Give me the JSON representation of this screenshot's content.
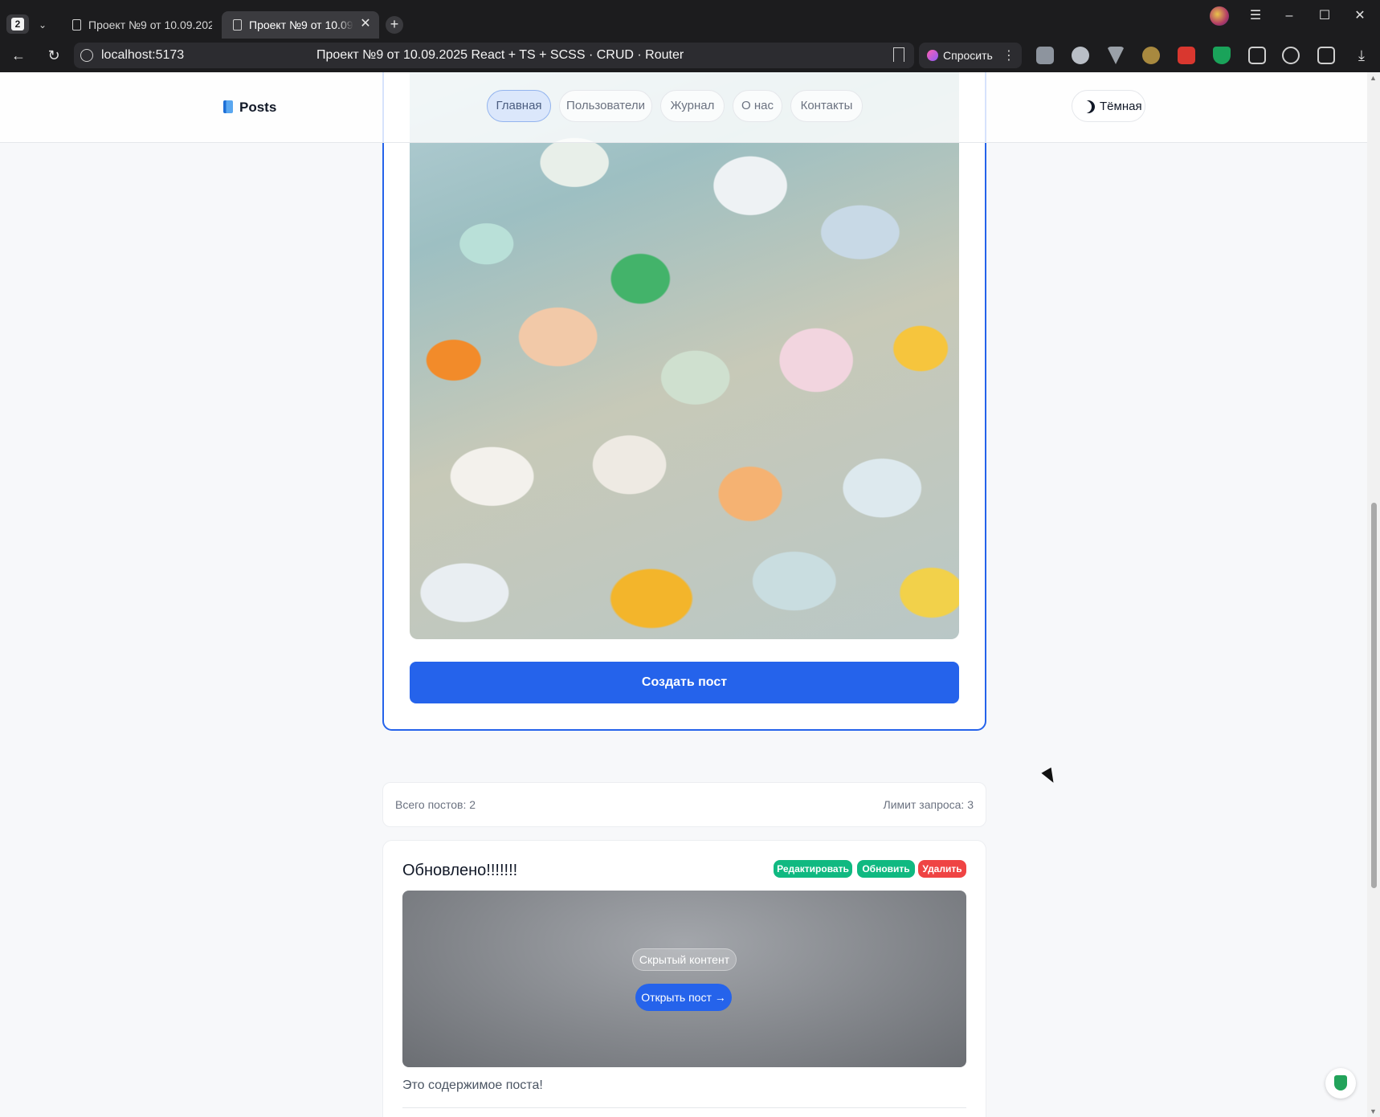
{
  "browser": {
    "tab_count": "2",
    "tabs": [
      {
        "label": "Проект №9 от 10.09.2025"
      },
      {
        "label": "Проект №9 от 10.09.2025"
      }
    ],
    "url": "localhost:5173",
    "page_title": "Проект №9 от 10.09.2025 React + TS + SCSS · CRUD · Router",
    "ask_label": "Спросить"
  },
  "header": {
    "logo": "Posts",
    "nav": [
      "Главная",
      "Пользователи",
      "Журнал",
      "О нас",
      "Контакты"
    ],
    "active_nav": "Главная",
    "theme_label": "Тёмная"
  },
  "form": {
    "submit_label": "Создать пост"
  },
  "stats": {
    "total": "Всего постов: 2",
    "limit": "Лимит запроса: 3"
  },
  "post": {
    "title": "Обновлено!!!!!!!",
    "actions": {
      "edit": "Редактировать",
      "update": "Обновить",
      "delete": "Удалить"
    },
    "hidden_label": "Скрытый контент",
    "open_label": "Открыть пост →",
    "body": "Это содержимое поста!"
  },
  "colors": {
    "accent": "#2563eb",
    "success": "#10b981",
    "danger": "#ef4444"
  }
}
